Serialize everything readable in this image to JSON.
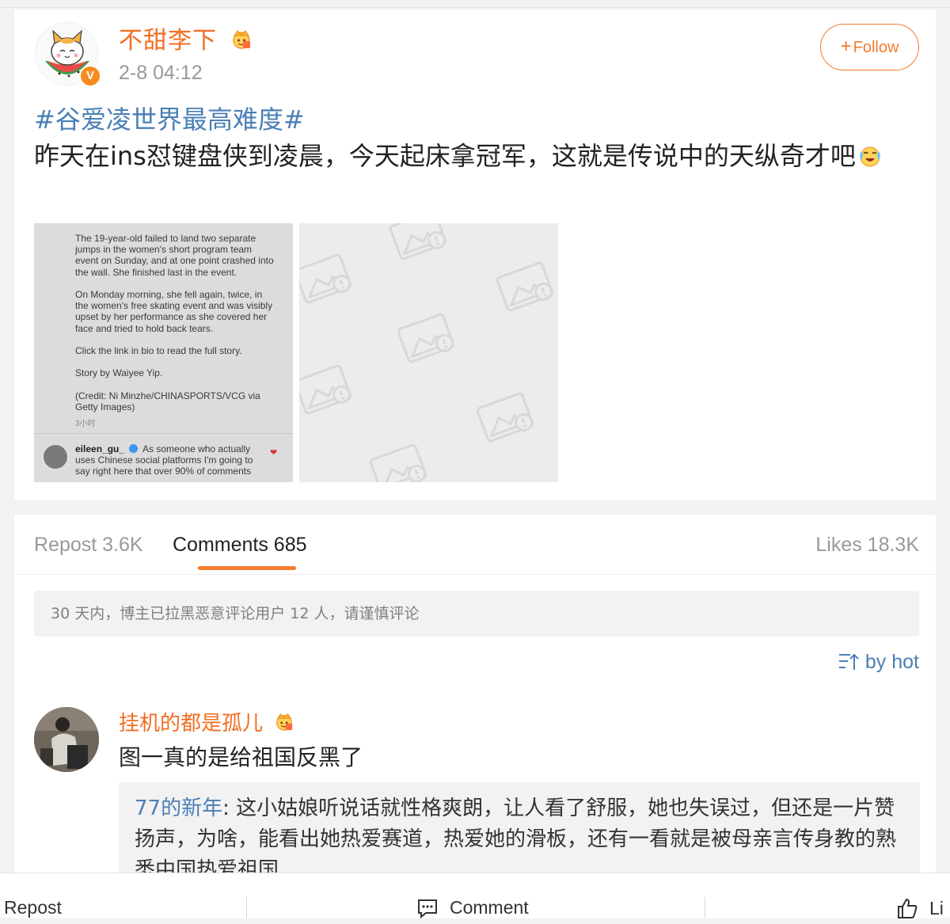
{
  "post": {
    "username": "不甜李下",
    "verified_badge": "V",
    "time": "2-8 04:12",
    "follow_label": "Follow",
    "hashtag": "#谷爱凌世界最高难度#",
    "body": "昨天在ins怼键盘侠到凌晨，今天起床拿冠军，这就是传说中的天纵奇才吧",
    "images": {
      "screenshot": {
        "article_text": "The 19-year-old failed to land two separate jumps in the women's short program team event on Sunday, and at one point crashed into the wall. She finished last in the event.\n\nOn Monday morning, she fell again, twice, in the women's free skating event and was visibly upset by her performance as she covered her face and tried to hold back tears.\n\nClick the link in bio to read the full story.\n\nStory by Waiyee Yip.\n\n(Credit: Ni Minzhe/CHINASPORTS/VCG via Getty Images)",
        "time_ago": "3小时",
        "comment_user": "eileen_gu_",
        "comment_text": "As someone who actually uses Chinese social platforms I'm going to say right here that over 90% of comments"
      },
      "placeholder_icon": "broken-image-icon"
    }
  },
  "stats": {
    "repost": "Repost 3.6K",
    "comments": "Comments 685",
    "likes": "Likes 18.3K"
  },
  "notice": "30 天内，博主已拉黑恶意评论用户 12 人，请谨慎评论",
  "sort_label": "by hot",
  "comment": {
    "username": "挂机的都是孤儿",
    "text": "图一真的是给祖国反黑了",
    "reply": {
      "username": "77的新年",
      "separator": ":",
      "text": " 这小姑娘听说话就性格爽朗，让人看了舒服，她也失误过，但还是一片赞扬声，为啥，能看出她热爱赛道，热爱她的滑板，还有一看就是被母亲言传身教的熟悉中国热爱祖国"
    }
  },
  "bottom_bar": {
    "repost": "Repost",
    "comment": "Comment",
    "like": "Li"
  },
  "colors": {
    "accent_orange": "#f57b2f",
    "username_orange": "#f26d22",
    "link_blue": "#4a7fb5"
  }
}
